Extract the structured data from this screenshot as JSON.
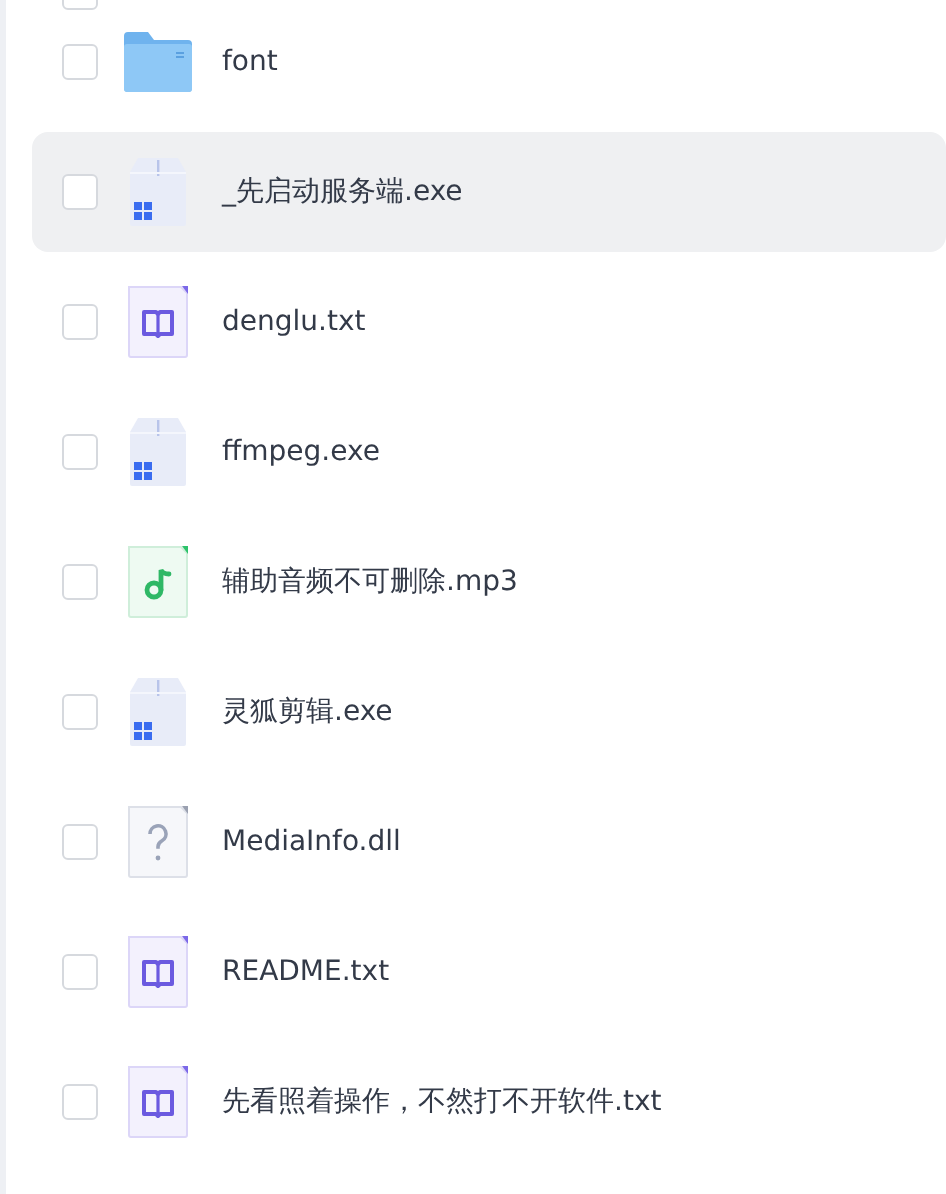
{
  "header": {
    "checked": false
  },
  "files": [
    {
      "name": "font",
      "kind": "folder",
      "checked": false,
      "highlighted": false
    },
    {
      "name": "_先启动服务端.exe",
      "kind": "exe",
      "checked": false,
      "highlighted": true
    },
    {
      "name": "denglu.txt",
      "kind": "txt",
      "checked": false,
      "highlighted": false
    },
    {
      "name": "ffmpeg.exe",
      "kind": "exe",
      "checked": false,
      "highlighted": false
    },
    {
      "name": "辅助音频不可删除.mp3",
      "kind": "audio",
      "checked": false,
      "highlighted": false
    },
    {
      "name": "灵狐剪辑.exe",
      "kind": "exe",
      "checked": false,
      "highlighted": false
    },
    {
      "name": "MediaInfo.dll",
      "kind": "unknown",
      "checked": false,
      "highlighted": false
    },
    {
      "name": "README.txt",
      "kind": "txt",
      "checked": false,
      "highlighted": false
    },
    {
      "name": "先看照着操作，不然打不开软件.txt",
      "kind": "txt",
      "checked": false,
      "highlighted": false
    }
  ]
}
